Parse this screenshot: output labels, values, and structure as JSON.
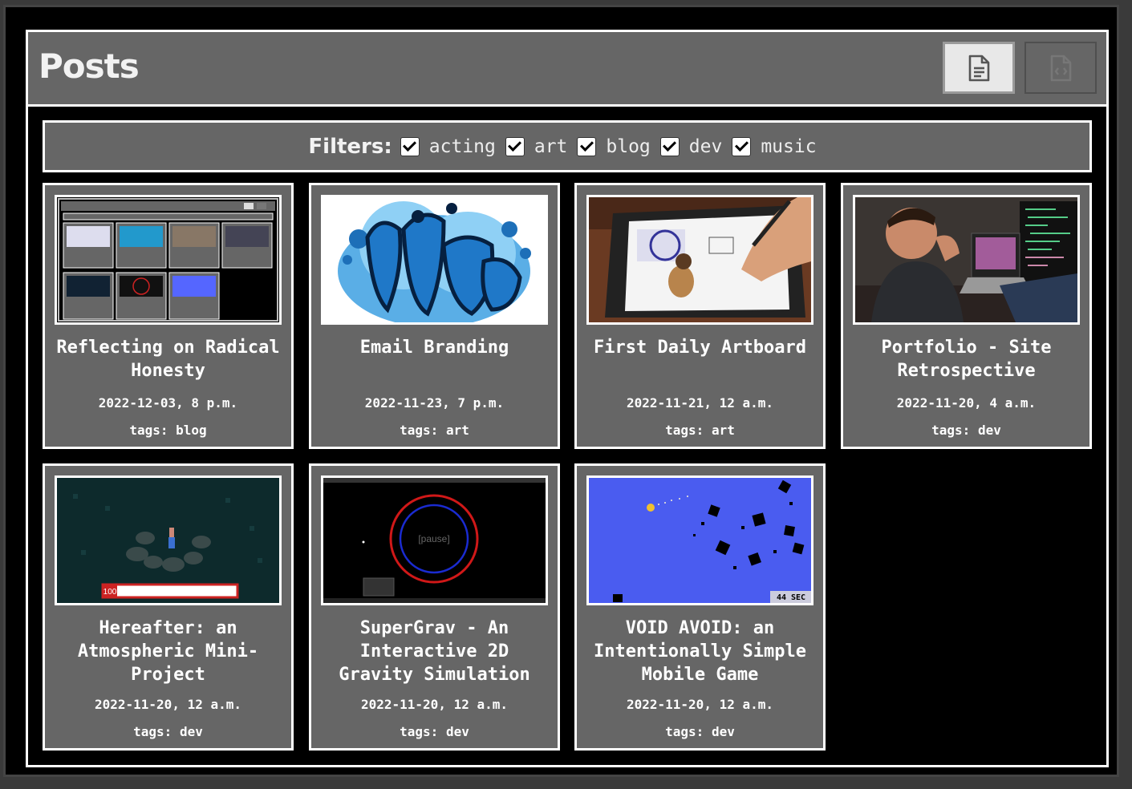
{
  "header": {
    "title": "Posts",
    "view_buttons": [
      {
        "name": "document-view",
        "icon": "document-icon",
        "active": true
      },
      {
        "name": "code-view",
        "icon": "code-file-icon",
        "active": false
      }
    ]
  },
  "filters": {
    "label": "Filters:",
    "items": [
      {
        "label": "acting",
        "checked": true
      },
      {
        "label": "art",
        "checked": true
      },
      {
        "label": "blog",
        "checked": true
      },
      {
        "label": "dev",
        "checked": true
      },
      {
        "label": "music",
        "checked": true
      }
    ]
  },
  "posts": [
    {
      "title": "Reflecting on Radical Honesty",
      "date": "2022-12-03, 8 p.m.",
      "tags": "tags: blog",
      "thumb": "site-screenshot"
    },
    {
      "title": "Email Branding",
      "date": "2022-11-23, 7 p.m.",
      "tags": "tags: art",
      "thumb": "graffiti-logo"
    },
    {
      "title": "First Daily Artboard",
      "date": "2022-11-21, 12 a.m.",
      "tags": "tags: art",
      "thumb": "drawing-tablet"
    },
    {
      "title": "Portfolio - Site Retrospective",
      "date": "2022-11-20, 4 a.m.",
      "tags": "tags: dev",
      "thumb": "developer-photo"
    },
    {
      "title": "Hereafter: an Atmospheric Mini-Project",
      "date": "2022-11-20, 12 a.m.",
      "tags": "tags: dev",
      "thumb": "game-scene",
      "thumb_text": "100"
    },
    {
      "title": "SuperGrav - An Interactive 2D Gravity Simulation",
      "date": "2022-11-20, 12 a.m.",
      "tags": "tags: dev",
      "thumb": "gravity-sim",
      "thumb_text": "[pause]"
    },
    {
      "title": "VOID AVOID: an Intentionally Simple Mobile Game",
      "date": "2022-11-20, 12 a.m.",
      "tags": "tags: dev",
      "thumb": "void-game",
      "thumb_text": "44 SEC"
    }
  ],
  "colors": {
    "panel": "#666666",
    "background": "#000000",
    "border": "#ffffff"
  }
}
